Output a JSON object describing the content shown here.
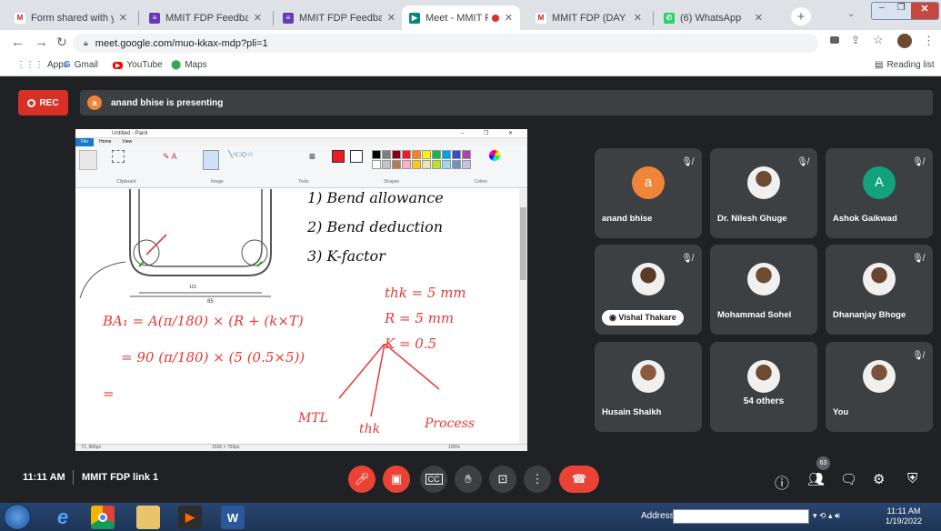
{
  "browser": {
    "tabs": [
      {
        "label": "Form shared with you: ",
        "icon": "gmail-icon",
        "color": "#ffffff",
        "mark": "M",
        "mc": "#c5221f"
      },
      {
        "label": "MMIT FDP Feedback F",
        "icon": "forms-icon",
        "color": "#673ab7",
        "mark": "≡",
        "mc": "#fff"
      },
      {
        "label": "MMIT FDP Feedback F",
        "icon": "forms-icon",
        "color": "#673ab7",
        "mark": "≡",
        "mc": "#fff"
      },
      {
        "label": "Meet - MMIT FDP",
        "icon": "meet-icon",
        "color": "#00897b",
        "mark": "▶",
        "mc": "#fff",
        "active": true
      },
      {
        "label": "MMIT FDP (DAY 2) LIN",
        "icon": "gmail-icon",
        "color": "#ffffff",
        "mark": "M",
        "mc": "#c5221f"
      },
      {
        "label": "(6) WhatsApp",
        "icon": "whatsapp-icon",
        "color": "#25d366",
        "mark": "✆",
        "mc": "#fff"
      }
    ],
    "new_tab": "+",
    "url": "meet.google.com/muo-kkax-mdp?pli=1",
    "bookmarks": [
      {
        "label": "Apps",
        "icon": "apps-icon"
      },
      {
        "label": "Gmail",
        "icon": "google-icon"
      },
      {
        "label": "YouTube",
        "icon": "youtube-icon"
      },
      {
        "label": "Maps",
        "icon": "maps-icon"
      }
    ],
    "reading_list": "Reading list"
  },
  "meet": {
    "rec": "REC",
    "presenter_initial": "a",
    "presenting_text": "anand bhise is presenting",
    "participants": [
      {
        "name": "anand bhise",
        "initial": "a",
        "color": "#f0853a",
        "pic": false,
        "muted": true
      },
      {
        "name": "Dr. Nilesh Ghuge",
        "pic": true,
        "muted": true
      },
      {
        "name": "Ashok Gaikwad",
        "initial": "A",
        "color": "#12a27d",
        "pic": false,
        "muted": true
      },
      {
        "name": "Vishal Thakare",
        "pic": true,
        "muted": true,
        "chip": true
      },
      {
        "name": "Mohammad Sohel",
        "pic": true,
        "muted": false
      },
      {
        "name": "Dhananjay Bhoge",
        "pic": true,
        "muted": true
      },
      {
        "name": "Husain Shaikh",
        "pic": true,
        "muted": false
      },
      {
        "name": "54 others",
        "pic": true,
        "muted": false
      },
      {
        "name": "You",
        "pic": true,
        "muted": true
      }
    ],
    "time": "11:11 AM",
    "meeting_name": "MMIT FDP link 1",
    "people_count": "63"
  },
  "paint": {
    "title": "Untitled - Paint",
    "menu": [
      "File",
      "Home",
      "View"
    ],
    "groups": [
      "Clipboard",
      "Image",
      "Tools",
      "Shapes",
      "Colors"
    ],
    "status_left": "71, 966px",
    "status_mid": "1536 × 763px",
    "zoom": "100%",
    "palette": [
      "#000000",
      "#7f7f7f",
      "#880015",
      "#ed1c24",
      "#ff7f27",
      "#fff200",
      "#22b14c",
      "#00a2e8",
      "#3f48cc",
      "#a349a4",
      "#ffffff",
      "#c3c3c3",
      "#b97a57",
      "#ffaec9",
      "#ffc90e",
      "#efe4b0",
      "#b5e61d",
      "#99d9ea",
      "#7092be",
      "#c8bfe7"
    ],
    "notes": [
      "1) Bend allowance",
      "2) Bend deduction",
      "3) K-factor",
      "thk = 5 mm",
      "R = 5 mm",
      "K = 0.5",
      "MTL",
      "thk",
      "Process"
    ],
    "formula": [
      "BA₁ = A(π/180) × (R + (k×T)",
      "= 90 (π/180) × (5 (0.5×5))",
      "="
    ],
    "dim_label": "85"
  },
  "taskbar": {
    "address_label": "Address",
    "clock_time": "11:11 AM",
    "clock_date": "1/19/2022"
  }
}
